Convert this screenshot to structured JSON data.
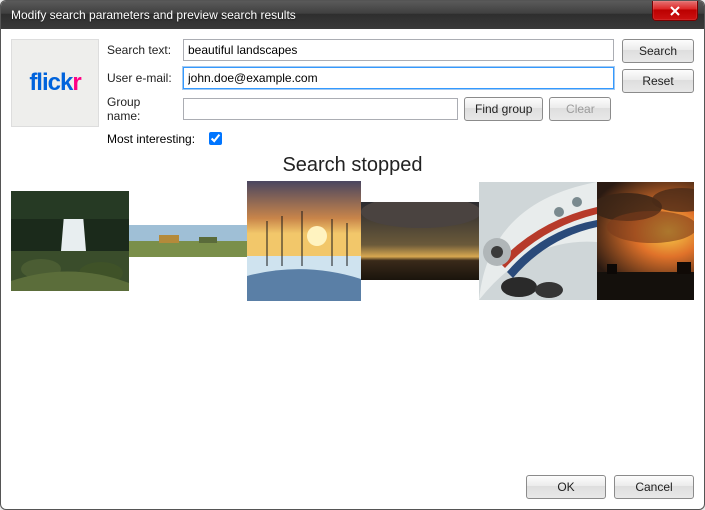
{
  "window": {
    "title": "Modify search parameters and preview search results"
  },
  "form": {
    "search_text_label": "Search text:",
    "search_text_value": "beautiful landscapes",
    "user_email_label": "User e-mail:",
    "user_email_value": "john.doe@example.com",
    "group_name_label": "Group name:",
    "group_name_value": "",
    "find_group_label": "Find group",
    "clear_label": "Clear",
    "most_interesting_label": "Most interesting:",
    "most_interesting_checked": true
  },
  "side": {
    "search_label": "Search",
    "reset_label": "Reset"
  },
  "status": "Search stopped",
  "footer": {
    "ok_label": "OK",
    "cancel_label": "Cancel"
  },
  "logo_text_main": "flick",
  "logo_text_accent": "r"
}
